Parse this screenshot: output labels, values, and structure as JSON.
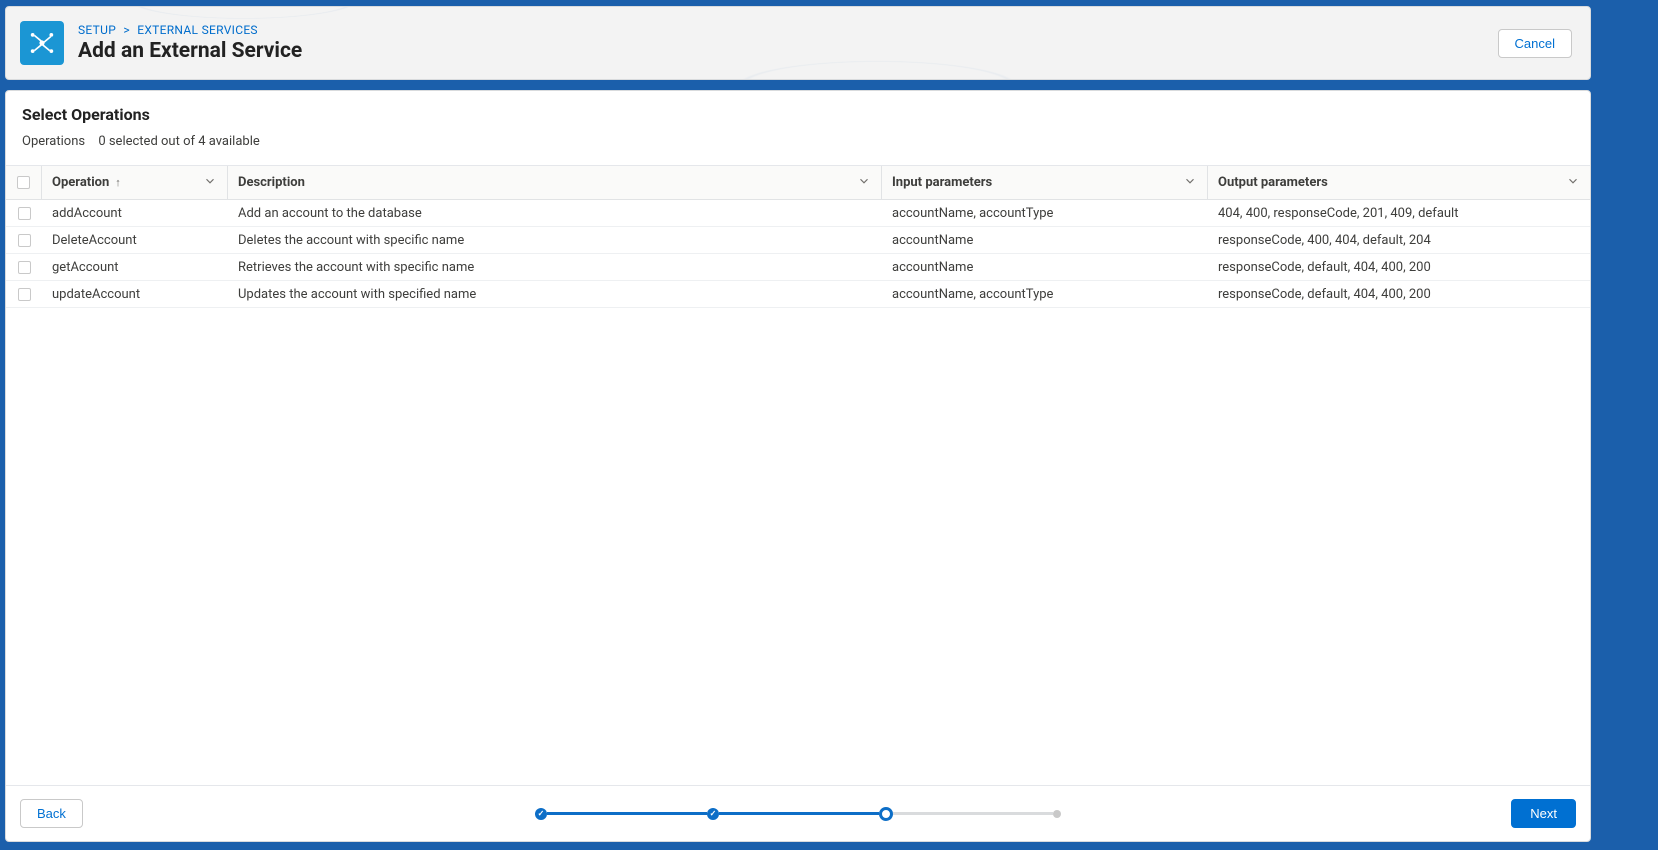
{
  "breadcrumb": {
    "setup": "SETUP",
    "external": "EXTERNAL SERVICES"
  },
  "page_title": "Add an External Service",
  "cancel_label": "Cancel",
  "section": {
    "title": "Select Operations",
    "sub_label": "Operations",
    "count_text": "0 selected out of 4 available"
  },
  "columns": {
    "operation": "Operation",
    "description": "Description",
    "input": "Input parameters",
    "output": "Output parameters"
  },
  "sort_indicator": "↑",
  "rows": [
    {
      "op": "addAccount",
      "desc": "Add an account to the database",
      "in": "accountName, accountType",
      "out": "404, 400, responseCode, 201, 409, default"
    },
    {
      "op": "DeleteAccount",
      "desc": "Deletes the account with specific name",
      "in": "accountName",
      "out": "responseCode, 400, 404, default, 204"
    },
    {
      "op": "getAccount",
      "desc": "Retrieves the account with specific name",
      "in": "accountName",
      "out": "responseCode, default, 404, 400, 200"
    },
    {
      "op": "updateAccount",
      "desc": "Updates the account with specified name",
      "in": "accountName, accountType",
      "out": "responseCode, default, 404, 400, 200"
    }
  ],
  "footer": {
    "back": "Back",
    "next": "Next"
  },
  "stepper": {
    "total": 4,
    "current_index": 2
  }
}
